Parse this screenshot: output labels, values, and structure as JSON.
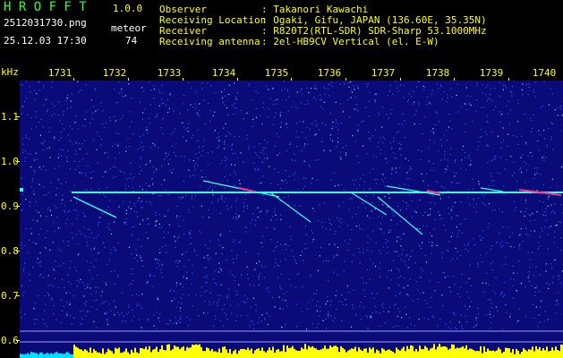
{
  "header": {
    "app_name": "H R O F F T",
    "version": "1.0.0",
    "filename": "2512031730.png",
    "datetime": "25.12.03 17:30",
    "meteor_label": "meteor",
    "meteor_count": "74",
    "info_labels": [
      "Observer",
      "Receiving Location",
      "Receiver",
      "Receiving antenna"
    ],
    "info_values": [
      ": Takanori Kawachi",
      ": Ogaki, Gifu, JAPAN (136.60E, 35.35N)",
      ": R820T2(RTL-SDR) SDR-Sharp 53.1000MHz",
      ": 2el-HB9CV Vertical (el. E-W)"
    ]
  },
  "axis": {
    "y_unit": "kHz",
    "x_ticks": [
      "1731",
      "1732",
      "1733",
      "1734",
      "1735",
      "1736",
      "1737",
      "1738",
      "1739",
      "1740"
    ],
    "y_ticks": [
      "1.1",
      "1.0",
      "0.9",
      "0.8",
      "0.7",
      "0.6"
    ]
  },
  "colors": {
    "background": "#0a0a78",
    "noise": "#2a5cff",
    "trace": "#33ffee",
    "accent": "#ff3388",
    "histogram": "#ffff00",
    "histogram_low": "#00ddff"
  }
}
